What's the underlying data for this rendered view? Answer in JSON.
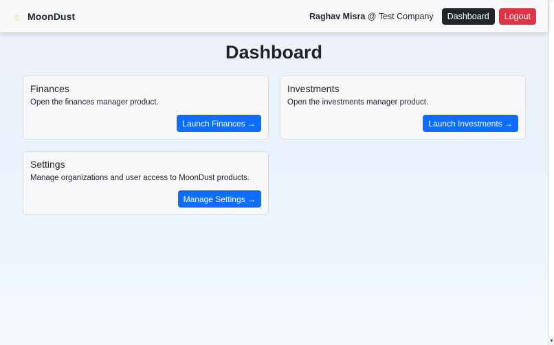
{
  "navbar": {
    "brand": "MoonDust",
    "brand_icon": "moon-icon",
    "user_name": "Raghav Misra",
    "user_org": "@ Test Company",
    "dashboard_label": "Dashboard",
    "logout_label": "Logout"
  },
  "main": {
    "title": "Dashboard",
    "cards": [
      {
        "title": "Finances",
        "description": "Open the finances manager product.",
        "button": "Launch Finances →"
      },
      {
        "title": "Investments",
        "description": "Open the investments manager product.",
        "button": "Launch Investments →"
      },
      {
        "title": "Settings",
        "description": "Manage organizations and user access to MoonDust products.",
        "button": "Manage Settings →"
      }
    ]
  },
  "colors": {
    "primary": "#0d6efd",
    "dark": "#212529",
    "danger": "#dc3545",
    "brand_accent": "#f5b400"
  }
}
